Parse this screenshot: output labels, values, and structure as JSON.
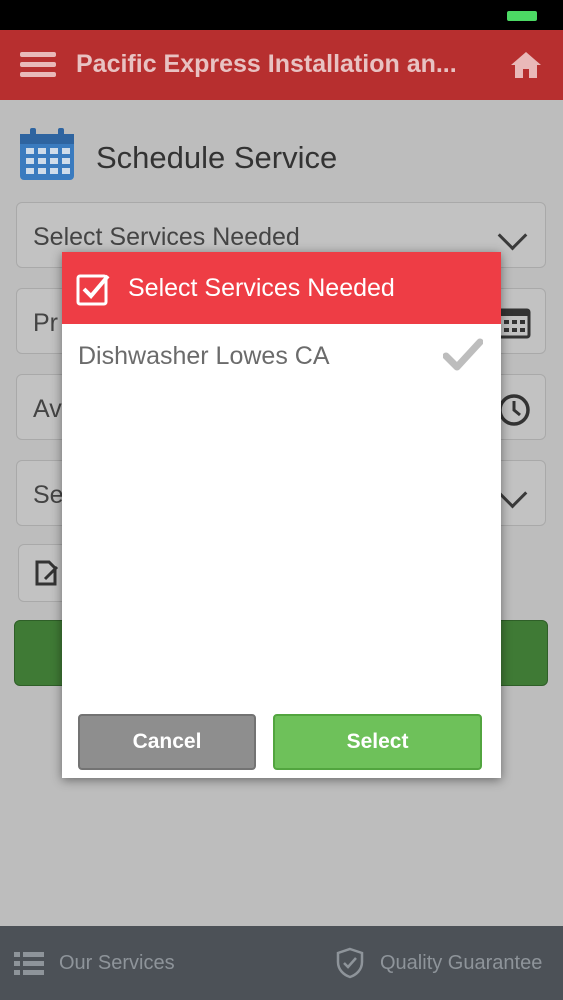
{
  "app": {
    "title": "Pacific Express Installation an...",
    "menu_icon": "hamburger-icon",
    "home_icon": "home-icon"
  },
  "page": {
    "icon": "calendar-icon",
    "title": "Schedule Service"
  },
  "form": {
    "services_placeholder": "Select Services Needed",
    "field2_visible": "Pr",
    "field3_visible": "Av",
    "field4_visible": "Se"
  },
  "modal": {
    "title": "Select Services Needed",
    "options": [
      {
        "label": "Dishwasher Lowes CA",
        "checked": true
      }
    ],
    "cancel_label": "Cancel",
    "select_label": "Select"
  },
  "bottom_nav": {
    "services_label": "Our Services",
    "quality_label": "Quality Guarantee"
  },
  "colors": {
    "appbar": "#b72f2f",
    "modal_header": "#ee3d45",
    "select_button": "#6ec15a",
    "cancel_button": "#8e8e8e",
    "bottom_nav": "#4c5157"
  }
}
